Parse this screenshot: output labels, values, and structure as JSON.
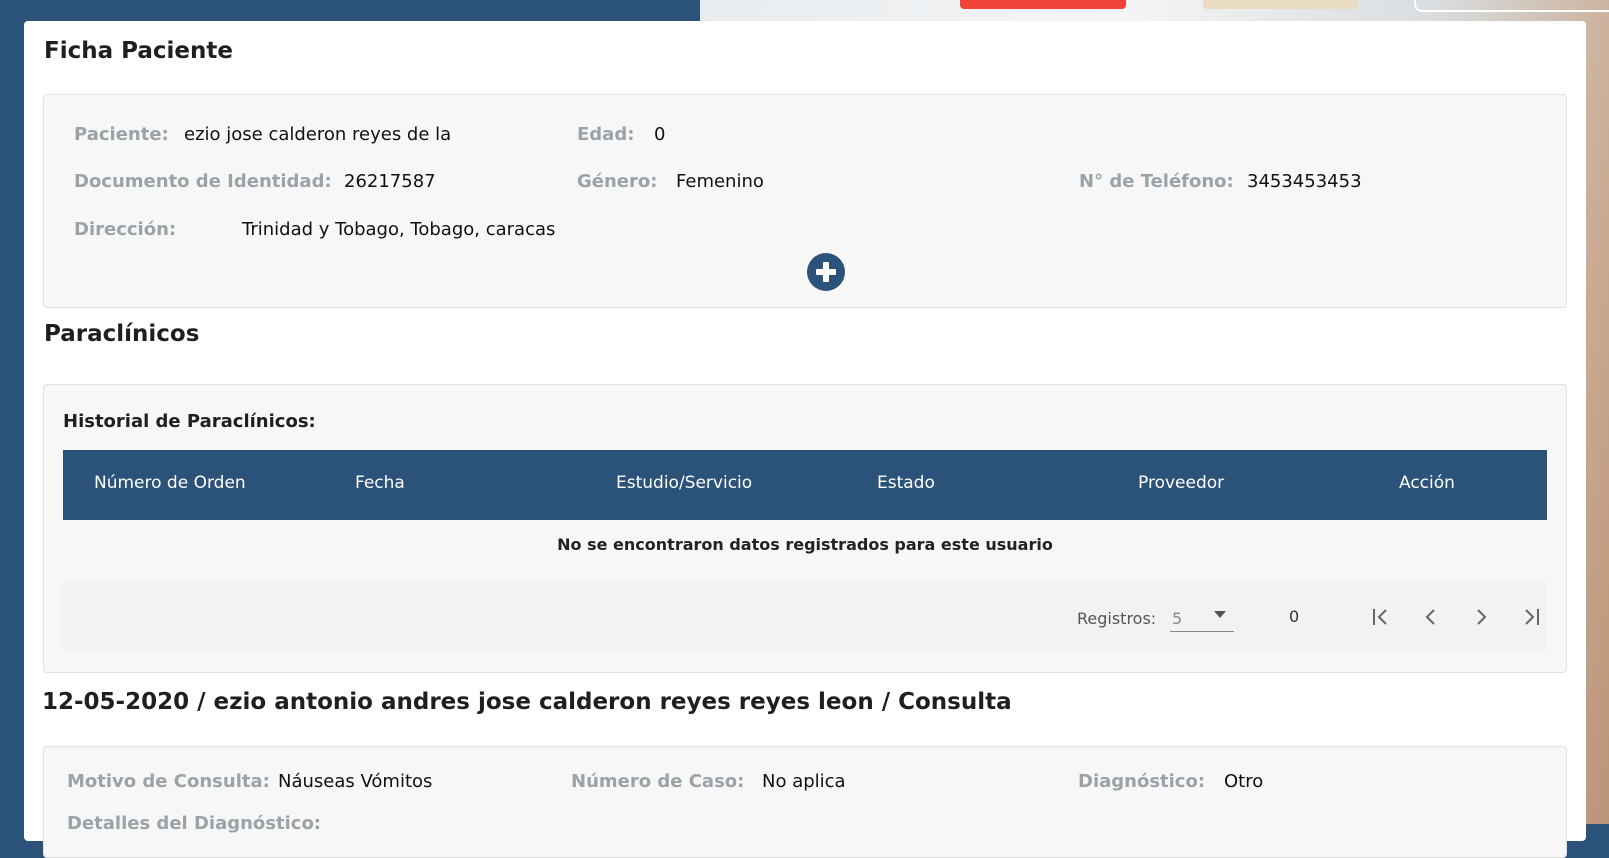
{
  "patient_card": {
    "title": "Ficha Paciente",
    "patient_label": "Paciente:",
    "patient_value": "ezio jose calderon reyes de la",
    "age_label": "Edad:",
    "age_value": "0",
    "doc_label": "Documento de Identidad:",
    "doc_value": "26217587",
    "gender_label": "Género:",
    "gender_value": "Femenino",
    "phone_label": "N° de Teléfono:",
    "phone_value": "3453453453",
    "address_label": "Dirección:",
    "address_value": "Trinidad y Tobago, Tobago, caracas",
    "add_icon": "plus-circle-icon"
  },
  "paraclinicos": {
    "title": "Paraclínicos",
    "history_title": "Historial de Paraclínicos:",
    "columns": [
      "Número de Orden",
      "Fecha",
      "Estudio/Servicio",
      "Estado",
      "Proveedor",
      "Acción"
    ],
    "empty_message": "No se encontraron datos registrados para este usuario",
    "pagination": {
      "records_label": "Registros:",
      "page_size": "5",
      "count": "0",
      "icons": [
        "first-page-icon",
        "prev-page-icon",
        "next-page-icon",
        "last-page-icon"
      ]
    }
  },
  "consulta": {
    "title": "12-05-2020 / ezio antonio andres jose calderon reyes reyes leon / Consulta",
    "reason_label": "Motivo de Consulta:",
    "reason_value": "Náuseas Vómitos",
    "case_label": "Número de Caso:",
    "case_value": "No aplica",
    "diagnosis_label": "Diagnóstico:",
    "diagnosis_value": "Otro",
    "details_label": "Detalles del Diagnóstico:"
  },
  "colors": {
    "primary": "#2b5279",
    "label_gray": "#9aa3a8",
    "accent_red": "#f04438"
  }
}
